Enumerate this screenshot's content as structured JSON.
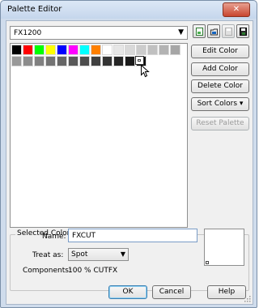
{
  "window": {
    "title": "Palette Editor",
    "close_glyph": "✕"
  },
  "palette_select": {
    "value": "FX1200"
  },
  "toolbar": {
    "icons": [
      "new-palette-icon",
      "open-palette-icon",
      "save-palette-icon",
      "save-as-palette-icon"
    ]
  },
  "swatches": {
    "row1": [
      "#000000",
      "#ff0000",
      "#00ff00",
      "#ffff00",
      "#0000ff",
      "#ff00ff",
      "#00ffff",
      "#ff8000",
      "#ffffff",
      "#e6e6e6",
      "#d9d9d9",
      "#cccccc",
      "#c0c0c0",
      "#b3b3b3",
      "#a6a6a6"
    ],
    "row2": [
      "#999999",
      "#8c8c8c",
      "#808080",
      "#737373",
      "#666666",
      "#595959",
      "#4d4d4d",
      "#404040",
      "#333333",
      "#262626",
      "#1a1a1a",
      "#0d0d0d"
    ]
  },
  "buttons": {
    "edit_color": "Edit Color",
    "add_color": "Add Color",
    "delete_color": "Delete Color",
    "sort_colors": "Sort Colors ▾",
    "reset_palette": "Reset Palette"
  },
  "selected_color": {
    "group_title": "Selected Color",
    "name_label": "Name:",
    "name_value": "FXCUT",
    "treat_label": "Treat as:",
    "treat_value": "Spot",
    "components_label": "Components:",
    "components_value": "100 % CUTFX"
  },
  "footer": {
    "ok": "OK",
    "cancel": "Cancel",
    "help": "Help"
  }
}
